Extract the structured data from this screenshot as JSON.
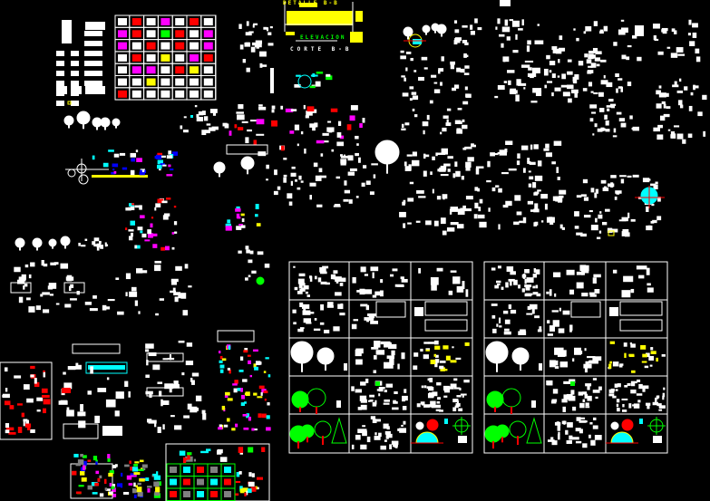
{
  "viewport": {
    "background": "#000000",
    "kind": "cad-model-space"
  },
  "colors": {
    "white": "#ffffff",
    "red": "#ff0000",
    "yellow": "#ffff00",
    "green": "#00ff00",
    "cyan": "#00ffff",
    "magenta": "#ff00ff",
    "blue": "#0000ff",
    "gray": "#808080"
  },
  "labels": {
    "elevation": "ELEVACION",
    "section": "CORTE B-B",
    "section_header": "DETALLE B-B"
  },
  "block_groups": [
    {
      "name": "vehicles-top-left",
      "content": "cars, vans, trucks (plan and elevation)"
    },
    {
      "name": "furniture-grid",
      "content": "7x7 grid of furniture/appliance blocks"
    },
    {
      "name": "section-detail",
      "content": "wall/slab section with hatch"
    },
    {
      "name": "trees-and-people",
      "content": "trees, people, plants"
    },
    {
      "name": "symbol-catalog-right",
      "content": "furniture, cars, plants symbols"
    },
    {
      "name": "sheet-a",
      "content": "block sheet 3x5 panels"
    },
    {
      "name": "sheet-b",
      "content": "block sheet 3x5 panels (copy)"
    },
    {
      "name": "vehicles-bottom-left",
      "content": "buses, trucks, cars"
    },
    {
      "name": "color-blocks-bottom",
      "content": "colored furniture blocks"
    }
  ]
}
